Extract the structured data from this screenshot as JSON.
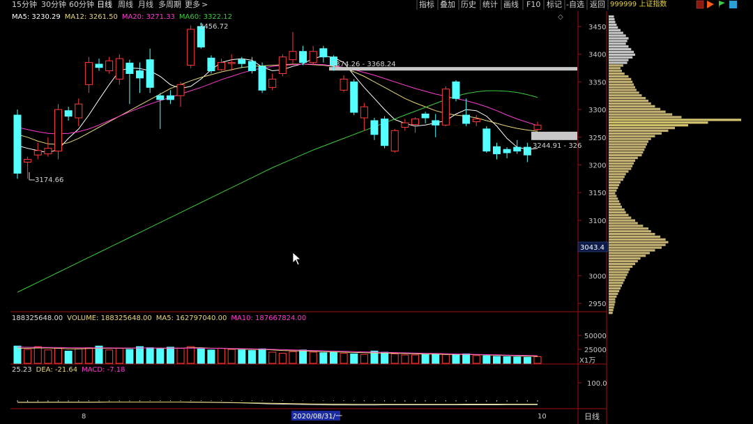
{
  "toolbar": {
    "tabs": [
      "15分钟",
      "30分钟",
      "60分钟",
      "日线",
      "周线",
      "月线",
      "多周期",
      "更多"
    ],
    "active_tab": "日线",
    "more_arrow": ">",
    "right_buttons": [
      "指标",
      "叠加",
      "历史",
      "统计",
      "画线",
      "F10",
      "标记",
      "-自选",
      "返回"
    ],
    "symbol": "999999 上证指数",
    "close_glyph": "◇"
  },
  "price_legend": [
    {
      "label": "MA5: 3230.29",
      "color": "#ffffff"
    },
    {
      "label": "MA12: 3261.50",
      "color": "#e8d87a"
    },
    {
      "label": "MA20: 3271.33",
      "color": "#ff3bd1"
    },
    {
      "label": "MA60: 3322.12",
      "color": "#3dcc3d"
    }
  ],
  "volume_legend": [
    {
      "label": "188325648.00",
      "color": "#dcdcdc"
    },
    {
      "label": "VOLUME: 188325648.00",
      "color": "#e8d87a"
    },
    {
      "label": "MA5: 162797040.00",
      "color": "#e8d87a"
    },
    {
      "label": "MA10: 187667824.00",
      "color": "#ff3bd1"
    }
  ],
  "macd_legend": [
    {
      "label": "25.23",
      "color": "#dcdcdc"
    },
    {
      "label": "DEA: -21.64",
      "color": "#e8d87a"
    },
    {
      "label": "MACD: -7.18",
      "color": "#ff3bd1"
    }
  ],
  "annotations": {
    "high": "3456.72",
    "low": "3174.66",
    "zone_top": "3374.26 - 3368.24",
    "zone_bottom": "3244.91 - 326",
    "current_price": "3043.4",
    "volume_unit": "X1万",
    "bottom_date": "2020/08/31/一",
    "bottom_tick_left": "8",
    "bottom_tick_right": "10",
    "period_label": "日线"
  },
  "colors": {
    "up": "#ff3c3c",
    "down": "#54ffff",
    "ma5": "#ffffff",
    "ma12": "#e8d87a",
    "ma20": "#ff3bd1",
    "ma60": "#3dcc3d",
    "zone": "#c8c8c8",
    "axis_box": "#a01010"
  },
  "chart_data": [
    {
      "type": "candlestick",
      "title": "",
      "ylim": [
        2930,
        3470
      ],
      "yticks": [
        3450,
        3400,
        3350,
        3300,
        3250,
        3200,
        3150,
        3100,
        3050,
        3000,
        2950
      ],
      "grid": false,
      "candles": [
        {
          "o": 3290,
          "c": 3185,
          "h": 3300,
          "l": 3175
        },
        {
          "o": 3205,
          "c": 3210,
          "h": 3215,
          "l": 3175
        },
        {
          "o": 3218,
          "c": 3226,
          "h": 3240,
          "l": 3210
        },
        {
          "o": 3220,
          "c": 3230,
          "h": 3250,
          "l": 3215
        },
        {
          "o": 3225,
          "c": 3300,
          "h": 3310,
          "l": 3210
        },
        {
          "o": 3298,
          "c": 3288,
          "h": 3305,
          "l": 3280
        },
        {
          "o": 3285,
          "c": 3310,
          "h": 3320,
          "l": 3270
        },
        {
          "o": 3345,
          "c": 3385,
          "h": 3395,
          "l": 3330
        },
        {
          "o": 3382,
          "c": 3376,
          "h": 3392,
          "l": 3370
        },
        {
          "o": 3370,
          "c": 3388,
          "h": 3395,
          "l": 3365
        },
        {
          "o": 3355,
          "c": 3392,
          "h": 3400,
          "l": 3345
        },
        {
          "o": 3384,
          "c": 3365,
          "h": 3390,
          "l": 3310
        },
        {
          "o": 3370,
          "c": 3357,
          "h": 3385,
          "l": 3330
        },
        {
          "o": 3390,
          "c": 3340,
          "h": 3410,
          "l": 3330
        },
        {
          "o": 3325,
          "c": 3318,
          "h": 3330,
          "l": 3265
        },
        {
          "o": 3325,
          "c": 3318,
          "h": 3335,
          "l": 3310
        },
        {
          "o": 3325,
          "c": 3345,
          "h": 3350,
          "l": 3305
        },
        {
          "o": 3380,
          "c": 3445,
          "h": 3452,
          "l": 3375
        },
        {
          "o": 3450,
          "c": 3413,
          "h": 3457,
          "l": 3410
        },
        {
          "o": 3393,
          "c": 3370,
          "h": 3398,
          "l": 3365
        },
        {
          "o": 3372,
          "c": 3385,
          "h": 3392,
          "l": 3370
        },
        {
          "o": 3385,
          "c": 3385,
          "h": 3400,
          "l": 3370
        },
        {
          "o": 3390,
          "c": 3383,
          "h": 3395,
          "l": 3375
        },
        {
          "o": 3387,
          "c": 3370,
          "h": 3395,
          "l": 3365
        },
        {
          "o": 3378,
          "c": 3335,
          "h": 3385,
          "l": 3330
        },
        {
          "o": 3340,
          "c": 3355,
          "h": 3365,
          "l": 3335
        },
        {
          "o": 3365,
          "c": 3395,
          "h": 3400,
          "l": 3360
        },
        {
          "o": 3390,
          "c": 3405,
          "h": 3440,
          "l": 3380
        },
        {
          "o": 3405,
          "c": 3385,
          "h": 3415,
          "l": 3380
        },
        {
          "o": 3385,
          "c": 3405,
          "h": 3415,
          "l": 3380
        },
        {
          "o": 3410,
          "c": 3395,
          "h": 3415,
          "l": 3385
        },
        {
          "o": 3395,
          "c": 3380,
          "h": 3398,
          "l": 3370
        },
        {
          "o": 3335,
          "c": 3355,
          "h": 3362,
          "l": 3332
        },
        {
          "o": 3350,
          "c": 3295,
          "h": 3355,
          "l": 3290
        },
        {
          "o": 3285,
          "c": 3305,
          "h": 3312,
          "l": 3262
        },
        {
          "o": 3280,
          "c": 3255,
          "h": 3285,
          "l": 3245
        },
        {
          "o": 3283,
          "c": 3235,
          "h": 3288,
          "l": 3230
        },
        {
          "o": 3225,
          "c": 3262,
          "h": 3265,
          "l": 3222
        },
        {
          "o": 3268,
          "c": 3276,
          "h": 3283,
          "l": 3262
        },
        {
          "o": 3273,
          "c": 3283,
          "h": 3286,
          "l": 3258
        },
        {
          "o": 3292,
          "c": 3285,
          "h": 3296,
          "l": 3275
        },
        {
          "o": 3280,
          "c": 3272,
          "h": 3292,
          "l": 3250
        },
        {
          "o": 3272,
          "c": 3337,
          "h": 3342,
          "l": 3270
        },
        {
          "o": 3350,
          "c": 3320,
          "h": 3353,
          "l": 3315
        },
        {
          "o": 3290,
          "c": 3275,
          "h": 3320,
          "l": 3270
        },
        {
          "o": 3278,
          "c": 3283,
          "h": 3290,
          "l": 3270
        },
        {
          "o": 3265,
          "c": 3225,
          "h": 3270,
          "l": 3222
        },
        {
          "o": 3233,
          "c": 3220,
          "h": 3240,
          "l": 3210
        },
        {
          "o": 3228,
          "c": 3222,
          "h": 3232,
          "l": 3212
        },
        {
          "o": 3232,
          "c": 3225,
          "h": 3245,
          "l": 3220
        },
        {
          "o": 3232,
          "c": 3218,
          "h": 3240,
          "l": 3205
        },
        {
          "o": 3264,
          "c": 3272,
          "h": 3278,
          "l": 3262
        }
      ],
      "ma_series": [
        {
          "name": "MA5",
          "values": [
            3235,
            3230,
            3226,
            3222,
            3228,
            3248,
            3265,
            3290,
            3318,
            3345,
            3370,
            3375,
            3374,
            3370,
            3360,
            3345,
            3338,
            3342,
            3355,
            3372,
            3385,
            3390,
            3392,
            3389,
            3377,
            3370,
            3372,
            3378,
            3383,
            3392,
            3397,
            3394,
            3385,
            3362,
            3340,
            3320,
            3300,
            3282,
            3275,
            3270,
            3272,
            3276,
            3280,
            3292,
            3300,
            3298,
            3288,
            3270,
            3248,
            3232,
            3228,
            3230
          ]
        },
        {
          "name": "MA12",
          "values": [
            3255,
            3250,
            3243,
            3238,
            3237,
            3240,
            3248,
            3258,
            3268,
            3278,
            3288,
            3298,
            3308,
            3318,
            3328,
            3338,
            3345,
            3352,
            3358,
            3363,
            3368,
            3372,
            3376,
            3378,
            3379,
            3380,
            3381,
            3382,
            3382,
            3381,
            3380,
            3378,
            3375,
            3368,
            3360,
            3350,
            3340,
            3330,
            3320,
            3312,
            3305,
            3298,
            3293,
            3290,
            3288,
            3285,
            3280,
            3275,
            3270,
            3266,
            3263,
            3261
          ]
        },
        {
          "name": "MA20",
          "values": [
            3268,
            3264,
            3260,
            3257,
            3256,
            3257,
            3260,
            3265,
            3272,
            3280,
            3288,
            3296,
            3303,
            3310,
            3316,
            3322,
            3328,
            3334,
            3340,
            3347,
            3354,
            3360,
            3366,
            3371,
            3375,
            3378,
            3380,
            3381,
            3382,
            3382,
            3381,
            3379,
            3376,
            3372,
            3367,
            3362,
            3356,
            3350,
            3344,
            3338,
            3333,
            3328,
            3324,
            3320,
            3316,
            3311,
            3305,
            3298,
            3290,
            3283,
            3277,
            3271
          ]
        },
        {
          "name": "MA60",
          "values": [
            2970,
            2979,
            2988,
            2997,
            3006,
            3015,
            3024,
            3033,
            3042,
            3051,
            3060,
            3069,
            3078,
            3087,
            3096,
            3105,
            3114,
            3123,
            3132,
            3141,
            3150,
            3159,
            3168,
            3177,
            3186,
            3195,
            3203,
            3211,
            3219,
            3227,
            3234,
            3241,
            3248,
            3255,
            3262,
            3269,
            3276,
            3283,
            3290,
            3297,
            3304,
            3311,
            3318,
            3324,
            3329,
            3332,
            3334,
            3334,
            3333,
            3331,
            3327,
            3322
          ]
        }
      ],
      "zones": [
        {
          "label": "3374.26 - 3368.24",
          "from": 3368.24,
          "to": 3374.26
        },
        {
          "label": "3244.91 - 326",
          "from": 3244.91,
          "to": 3260
        }
      ]
    },
    {
      "type": "bar",
      "title": "VOLUME",
      "ylim": [
        0,
        70000
      ],
      "yticks": [
        50000,
        25000
      ],
      "unit": "X1万",
      "values": [
        31000,
        25000,
        30000,
        24000,
        27000,
        22000,
        26000,
        28000,
        31000,
        24000,
        27000,
        25000,
        30000,
        28000,
        26000,
        29000,
        27000,
        30000,
        26000,
        24000,
        27000,
        25000,
        24000,
        23000,
        26000,
        20000,
        18000,
        21000,
        24000,
        20000,
        19000,
        20000,
        18000,
        17000,
        16000,
        22000,
        20000,
        17000,
        15000,
        15000,
        16000,
        17000,
        16000,
        15000,
        17000,
        14000,
        13500,
        12500,
        12000,
        11500,
        11000,
        12000
      ],
      "ma5": [
        27000,
        27000,
        27500,
        27500,
        27000,
        26000,
        26000,
        26500,
        27000,
        27000,
        27000,
        27000,
        27500,
        27500,
        27000,
        27000,
        27000,
        28000,
        28000,
        27000,
        27000,
        26000,
        25500,
        25000,
        25000,
        24000,
        23000,
        22500,
        22000,
        21500,
        21000,
        20500,
        20000,
        19500,
        19000,
        18500,
        18500,
        18000,
        17500,
        17000,
        16500,
        16500,
        16000,
        16000,
        16000,
        15500,
        15000,
        14500,
        14000,
        13500,
        13000,
        12500
      ],
      "ma10": [
        29000,
        28800,
        28600,
        28400,
        28200,
        28000,
        27800,
        27600,
        27600,
        27600,
        27500,
        27500,
        27500,
        27500,
        27500,
        27400,
        27300,
        27200,
        27100,
        27000,
        26800,
        26500,
        26200,
        26000,
        25500,
        25000,
        24500,
        24000,
        23500,
        23000,
        22500,
        22000,
        21500,
        21000,
        20500,
        20000,
        19600,
        19200,
        18800,
        18400,
        18000,
        17600,
        17200,
        16800,
        16400,
        16000,
        15600,
        15200,
        14800,
        14400,
        14000,
        13600
      ]
    },
    {
      "type": "bar",
      "title": "MACD",
      "ylim": [
        -60,
        130
      ],
      "yticks": [
        100.0
      ],
      "values": [
        -8,
        -8,
        -7,
        -7,
        -6,
        -6,
        -6,
        -5,
        -5,
        -5,
        -5,
        -5,
        -5,
        -4,
        -4,
        -4,
        -4,
        -4,
        -4,
        -3,
        -3,
        -3,
        -3,
        -3,
        -3,
        -3,
        -3,
        -2,
        -2,
        -2,
        -3,
        -3,
        -4,
        -4,
        -5,
        -5,
        -6,
        -6,
        -7,
        -7,
        -6,
        -6,
        -6,
        -6,
        -6,
        -7,
        -7,
        -7,
        -7,
        -7,
        -7,
        -7
      ],
      "dif": [
        -12,
        -12,
        -12,
        -11,
        -11,
        -11,
        -11,
        -11,
        -11,
        -10,
        -10,
        -10,
        -10,
        -10,
        -10,
        -10,
        -10,
        -11,
        -11,
        -12,
        -13,
        -14,
        -15,
        -17,
        -19,
        -21,
        -22,
        -23,
        -24,
        -25,
        -26,
        -27,
        -27,
        -27,
        -27,
        -27,
        -26,
        -26,
        -26,
        -26,
        -26,
        -26,
        -26,
        -26,
        -26,
        -26,
        -26,
        -26,
        -25,
        -25,
        -25,
        -25
      ],
      "dea": [
        -11,
        -11,
        -11,
        -11,
        -11,
        -11,
        -11,
        -11,
        -10,
        -10,
        -10,
        -10,
        -10,
        -10,
        -10,
        -10,
        -10,
        -10,
        -11,
        -11,
        -12,
        -13,
        -14,
        -15,
        -16,
        -17,
        -18,
        -19,
        -20,
        -21,
        -21,
        -22,
        -22,
        -23,
        -23,
        -23,
        -23,
        -23,
        -23,
        -23,
        -23,
        -23,
        -23,
        -23,
        -22,
        -22,
        -22,
        -22,
        -22,
        -22,
        -22,
        -22
      ]
    },
    {
      "type": "bar",
      "title": "volume-profile",
      "orientation": "horizontal",
      "ylim": [
        2930,
        3470
      ],
      "values": [
        8,
        9,
        10,
        12,
        14,
        18,
        22,
        26,
        30,
        28,
        26,
        30,
        34,
        38,
        40,
        36,
        30,
        28,
        22,
        18,
        20,
        24,
        30,
        34,
        36,
        38,
        40,
        42,
        46,
        50,
        56,
        60,
        64,
        70,
        78,
        86,
        96,
        110,
        200,
        150,
        120,
        100,
        90,
        80,
        70,
        64,
        60,
        58,
        56,
        54,
        52,
        50,
        44,
        40,
        38,
        36,
        34,
        30,
        26,
        24,
        22,
        18,
        16,
        14,
        12,
        10,
        12,
        14,
        16,
        18,
        20,
        24,
        26,
        30,
        34,
        40,
        44,
        52,
        60,
        64,
        70,
        78,
        86,
        90,
        86,
        80,
        70,
        62,
        56,
        48,
        44,
        40,
        36,
        32,
        30,
        28,
        26,
        24,
        22,
        20,
        18,
        16,
        14,
        12,
        10,
        10,
        9,
        8,
        7,
        6
      ]
    }
  ]
}
